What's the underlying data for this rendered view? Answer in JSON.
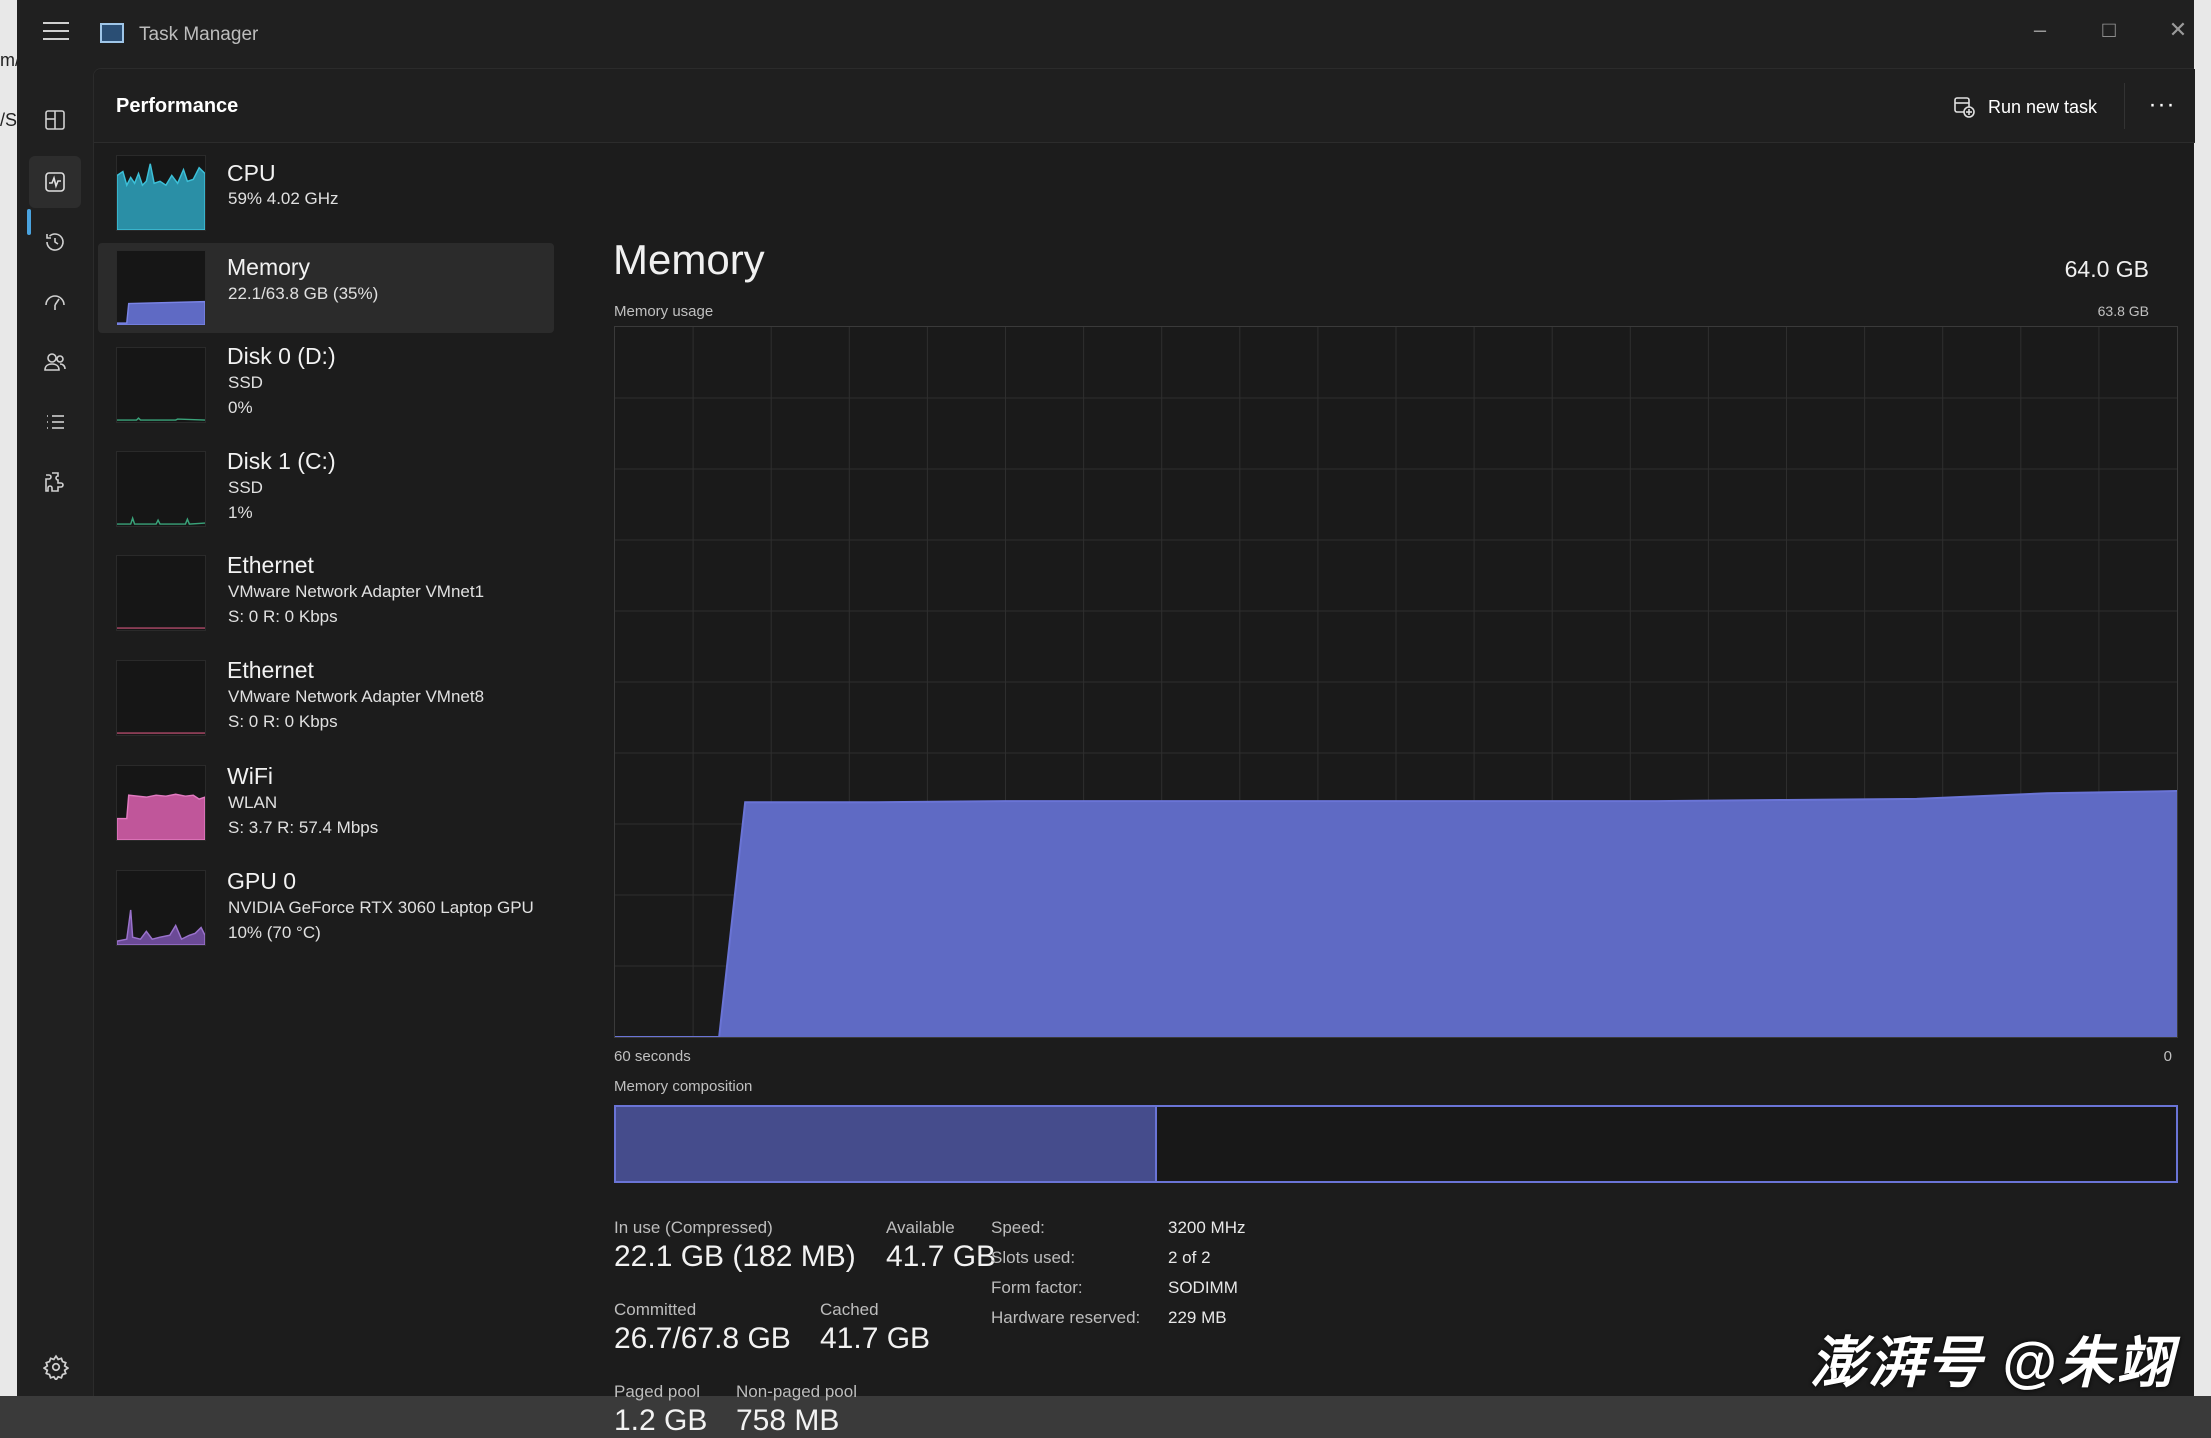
{
  "window": {
    "title": "Task Manager"
  },
  "header": {
    "title": "Performance",
    "run_task": "Run new task",
    "more": "···"
  },
  "devices": [
    {
      "name": "CPU",
      "line1": "59%  4.02 GHz",
      "line2": ""
    },
    {
      "name": "Memory",
      "line1": "22.1/63.8 GB (35%)",
      "line2": ""
    },
    {
      "name": "Disk 0 (D:)",
      "line1": "SSD",
      "line2": "0%"
    },
    {
      "name": "Disk 1 (C:)",
      "line1": "SSD",
      "line2": "1%"
    },
    {
      "name": "Ethernet",
      "line1": "VMware Network Adapter VMnet1",
      "line2": "S: 0  R: 0 Kbps"
    },
    {
      "name": "Ethernet",
      "line1": "VMware Network Adapter VMnet8",
      "line2": "S: 0  R: 0 Kbps"
    },
    {
      "name": "WiFi",
      "line1": "WLAN",
      "line2": "S: 3.7  R: 57.4 Mbps"
    },
    {
      "name": "GPU 0",
      "line1": "NVIDIA GeForce RTX 3060 Laptop GPU",
      "line2": "10%  (70 °C)"
    }
  ],
  "memory": {
    "title": "Memory",
    "total": "64.0 GB",
    "usage_label": "Memory usage",
    "usage_max": "63.8 GB",
    "time_left": "60 seconds",
    "time_right": "0",
    "composition_label": "Memory composition",
    "in_use_fraction": 0.347
  },
  "stats": {
    "in_use_label": "In use (Compressed)",
    "in_use": "22.1 GB (182 MB)",
    "available_label": "Available",
    "available": "41.7 GB",
    "committed_label": "Committed",
    "committed": "26.7/67.8 GB",
    "cached_label": "Cached",
    "cached": "41.7 GB",
    "paged_label": "Paged pool",
    "paged": "1.2 GB",
    "nonpaged_label": "Non-paged pool",
    "nonpaged": "758 MB"
  },
  "specs": {
    "speed_label": "Speed:",
    "speed": "3200 MHz",
    "slots_label": "Slots used:",
    "slots": "2 of 2",
    "form_label": "Form factor:",
    "form": "SODIMM",
    "reserved_label": "Hardware reserved:",
    "reserved": "229 MB"
  },
  "watermark": "澎湃号 @朱翊",
  "colors": {
    "memory": "#6a74d6",
    "cpu": "#2aa3b8",
    "wifi": "#d86fb0",
    "gpu": "#8a5fb8",
    "accent": "#4aa3df"
  },
  "chart_data": {
    "type": "area",
    "title": "Memory usage",
    "x": [
      60,
      56,
      55,
      50,
      45,
      40,
      35,
      30,
      25,
      20,
      15,
      10,
      5,
      0
    ],
    "values": [
      0,
      0,
      21.1,
      21.1,
      21.2,
      21.2,
      21.2,
      21.2,
      21.2,
      21.2,
      21.3,
      21.4,
      21.9,
      22.1
    ],
    "ylim": [
      0,
      63.8
    ],
    "xlabel": "60 seconds",
    "grid": true
  }
}
